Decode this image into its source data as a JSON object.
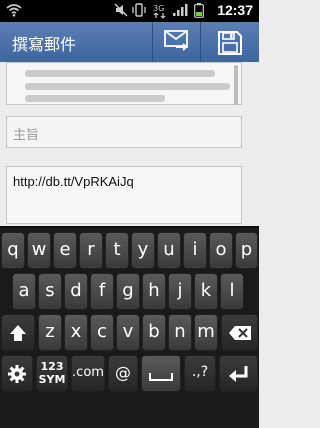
{
  "status": {
    "time": "12:37"
  },
  "header": {
    "title": "撰寫郵件"
  },
  "compose": {
    "subject_placeholder": "主旨",
    "body_text": "http://db.tt/VpRKAiJq"
  },
  "keyboard": {
    "row1": [
      "q",
      "w",
      "e",
      "r",
      "t",
      "y",
      "u",
      "i",
      "o",
      "p"
    ],
    "row2": [
      "a",
      "s",
      "d",
      "f",
      "g",
      "h",
      "j",
      "k",
      "l"
    ],
    "row3": [
      "z",
      "x",
      "c",
      "v",
      "b",
      "n",
      "m"
    ],
    "sym_top": "123",
    "sym_bottom": "SYM",
    "dotcom": ".com",
    "at": "@",
    "punct": ".,?"
  }
}
